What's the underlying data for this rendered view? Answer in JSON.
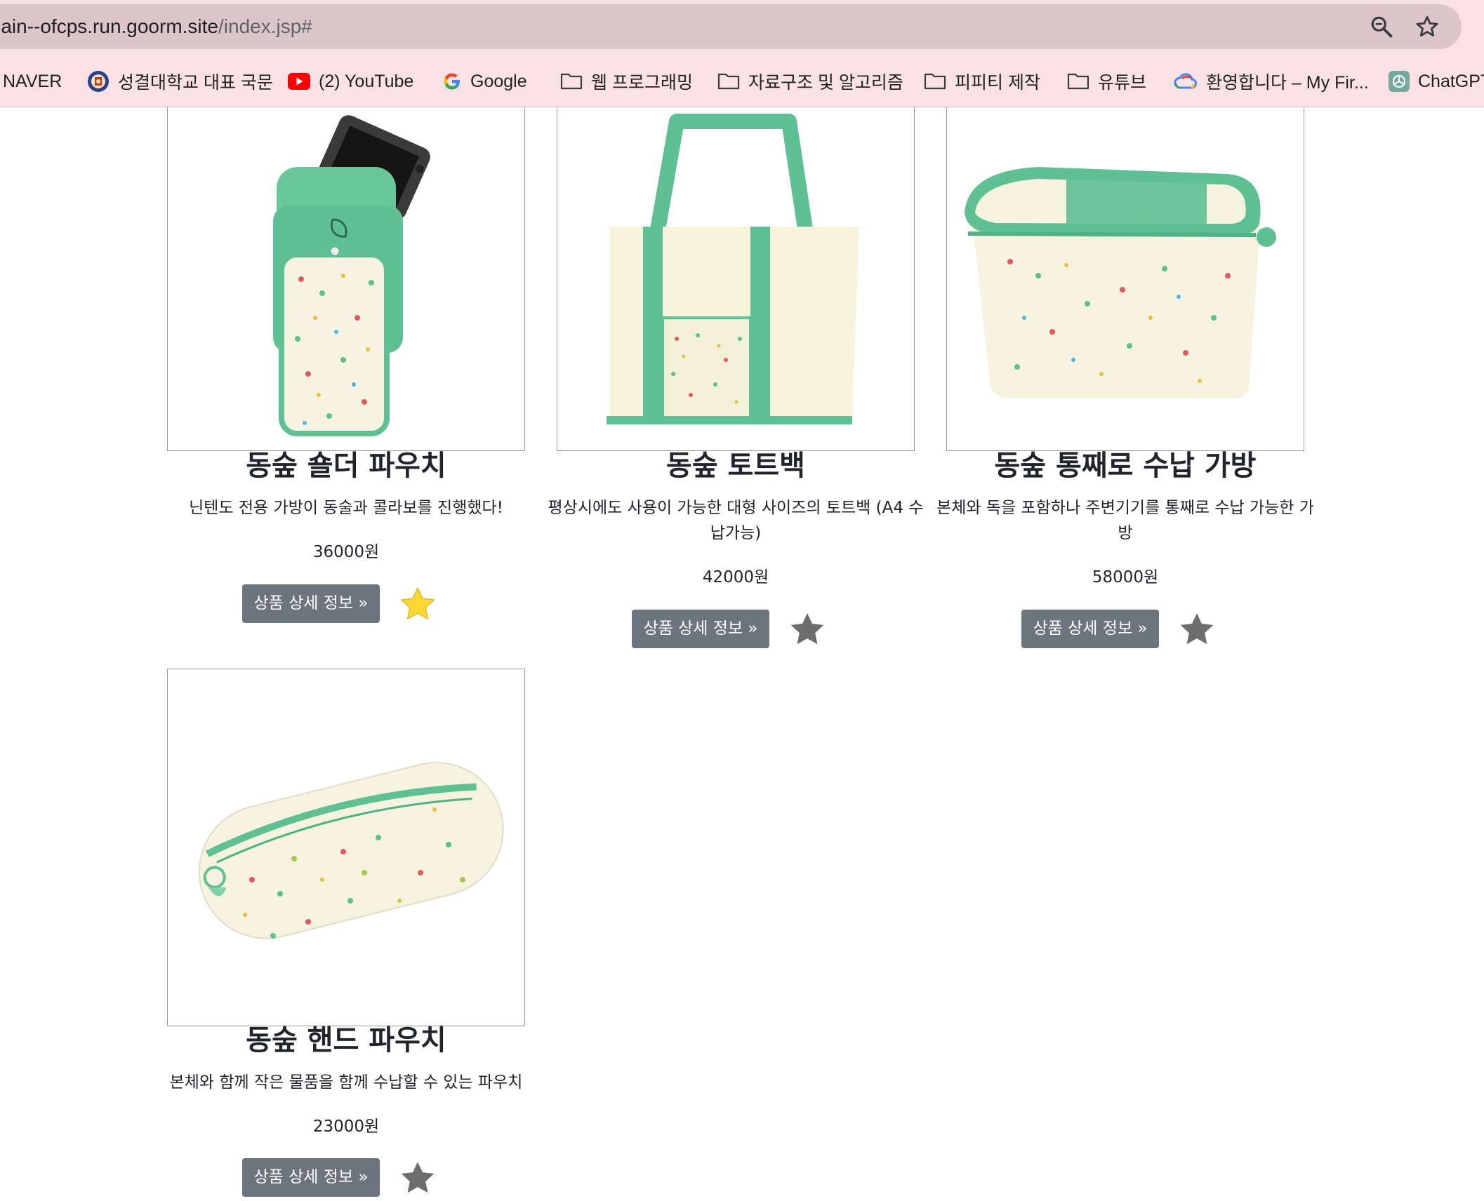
{
  "browser": {
    "url_host": "main--ofcps.run.goorm.site",
    "url_path": "/index.jsp#",
    "bookmarks": [
      {
        "label": "NAVER",
        "icon": "naver-icon"
      },
      {
        "label": "성결대학교 대표 국문",
        "icon": "university-seal-icon"
      },
      {
        "label": "(2) YouTube",
        "icon": "youtube-icon"
      },
      {
        "label": "Google",
        "icon": "google-icon"
      },
      {
        "label": "웹 프로그래밍",
        "icon": "folder-icon"
      },
      {
        "label": "자료구조 및 알고리즘",
        "icon": "folder-icon"
      },
      {
        "label": "피피티 제작",
        "icon": "folder-icon"
      },
      {
        "label": "유튜브",
        "icon": "folder-icon"
      },
      {
        "label": "환영합니다 – My Fir...",
        "icon": "google-cloud-icon"
      },
      {
        "label": "ChatGPT",
        "icon": "chatgpt-icon"
      }
    ]
  },
  "products": [
    {
      "name": "동숲 숄더 파우치",
      "description": "닌텐도 전용 가방이 동술과 콜라보를 진행했다!",
      "price": "36000원",
      "button": "상품 상세 정보 »",
      "favorite": true,
      "image": "shoulder-pouch-image"
    },
    {
      "name": "동숲 토트백",
      "description": "평상시에도 사용이 가능한 대형 사이즈의 토트백 (A4 수납가능)",
      "price": "42000원",
      "button": "상품 상세 정보 »",
      "favorite": false,
      "image": "tote-bag-image"
    },
    {
      "name": "동숲 통째로 수납 가방",
      "description": "본체와 독을 포함하나 주변기기를 통째로 수납 가능한 가방",
      "price": "58000원",
      "button": "상품 상세 정보 »",
      "favorite": false,
      "image": "storage-bag-image"
    },
    {
      "name": "동숲 핸드 파우치",
      "description": "본체와 함께 작은 물품을 함께 수납할 수 있는 파우치",
      "price": "23000원",
      "button": "상품 상세 정보 »",
      "favorite": false,
      "image": "hand-pouch-image"
    }
  ],
  "colors": {
    "favorite_on": "#fdd835",
    "favorite_off": "#6d6d6d",
    "button_bg": "#6c757d",
    "accent_green": "#5dc395"
  }
}
